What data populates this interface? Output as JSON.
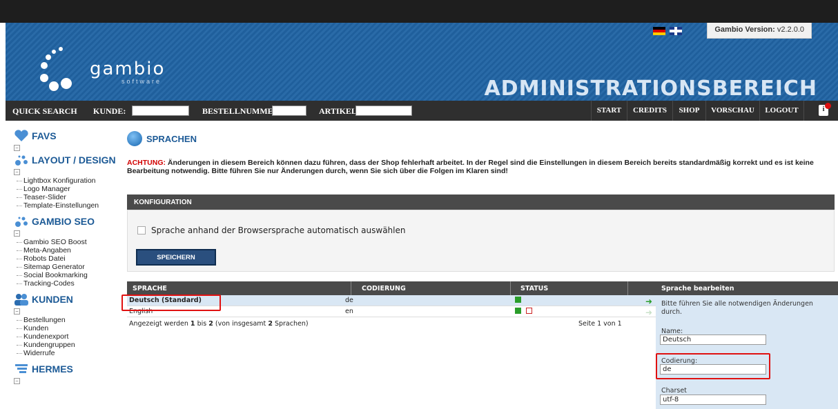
{
  "header": {
    "logo_text": "gambio",
    "logo_sub": "software",
    "version_label": "Gambio Version:",
    "version_value": "v2.2.0.0",
    "admin_title": "ADMINISTRATIONSBEREICH"
  },
  "navbar": {
    "quick_search": "QUICK SEARCH",
    "kunde_label": "KUNDE:",
    "bestellnummer_label": "BESTELLNUMMER:",
    "artikel_label": "ARTIKEL:",
    "buttons": [
      "START",
      "CREDITS",
      "SHOP",
      "VORSCHAU",
      "LOGOUT"
    ]
  },
  "sidebar": {
    "favs": "FAVS",
    "layout_title": "LAYOUT / DESIGN",
    "layout_items": [
      "Lightbox Konfiguration",
      "Logo Manager",
      "Teaser-Slider",
      "Template-Einstellungen"
    ],
    "seo_title": "GAMBIO SEO",
    "seo_items": [
      "Gambio SEO Boost",
      "Meta-Angaben",
      "Robots Datei",
      "Sitemap Generator",
      "Social Bookmarking",
      "Tracking-Codes"
    ],
    "kunden_title": "KUNDEN",
    "kunden_items": [
      "Bestellungen",
      "Kunden",
      "Kundenexport",
      "Kundengruppen",
      "Widerrufe"
    ],
    "hermes_title": "HERMES"
  },
  "main": {
    "page_title": "SPRACHEN",
    "warning_prefix": "ACHTUNG:",
    "warning_text": " Änderungen in diesem Bereich können dazu führen, dass der Shop fehlerhaft arbeitet. In der Regel sind die Einstellungen in diesem Bereich bereits standardmäßig korrekt und es ist keine Bearbeitung notwendig. Bitte führen Sie nur Änderungen durch, wenn Sie sich über die Folgen im Klaren sind!",
    "config_header": "KONFIGURATION",
    "checkbox_label": "Sprache anhand der Browsersprache automatisch auswählen",
    "save_button": "SPEICHERN"
  },
  "table": {
    "columns": [
      "SPRACHE",
      "CODIERUNG",
      "STATUS"
    ],
    "rows": [
      {
        "sprache": "Deutsch (Standard)",
        "codierung": "de"
      },
      {
        "sprache": "English",
        "codierung": "en"
      }
    ],
    "footer_pre": "Angezeigt werden ",
    "footer_from": "1",
    "footer_mid": " bis ",
    "footer_to": "2",
    "footer_pre2": " (von insgesamt ",
    "footer_total": "2",
    "footer_post": " Sprachen)",
    "pagination": "Seite 1 von 1"
  },
  "edit_panel": {
    "title": "Sprache bearbeiten",
    "hint": "Bitte führen Sie alle notwendigen Änderungen durch.",
    "name_label": "Name:",
    "name_value": "Deutsch",
    "codierung_label": "Codierung:",
    "codierung_value": "de",
    "charset_label": "Charset",
    "charset_value": "utf-8"
  },
  "colors": {
    "header_blue": "#1f5f9c",
    "nav_dark": "#2f2f2f",
    "section_blue": "#1c5a96",
    "warning_red": "#d10000",
    "highlight_red": "#e01010",
    "status_green": "#2a9d2a"
  }
}
